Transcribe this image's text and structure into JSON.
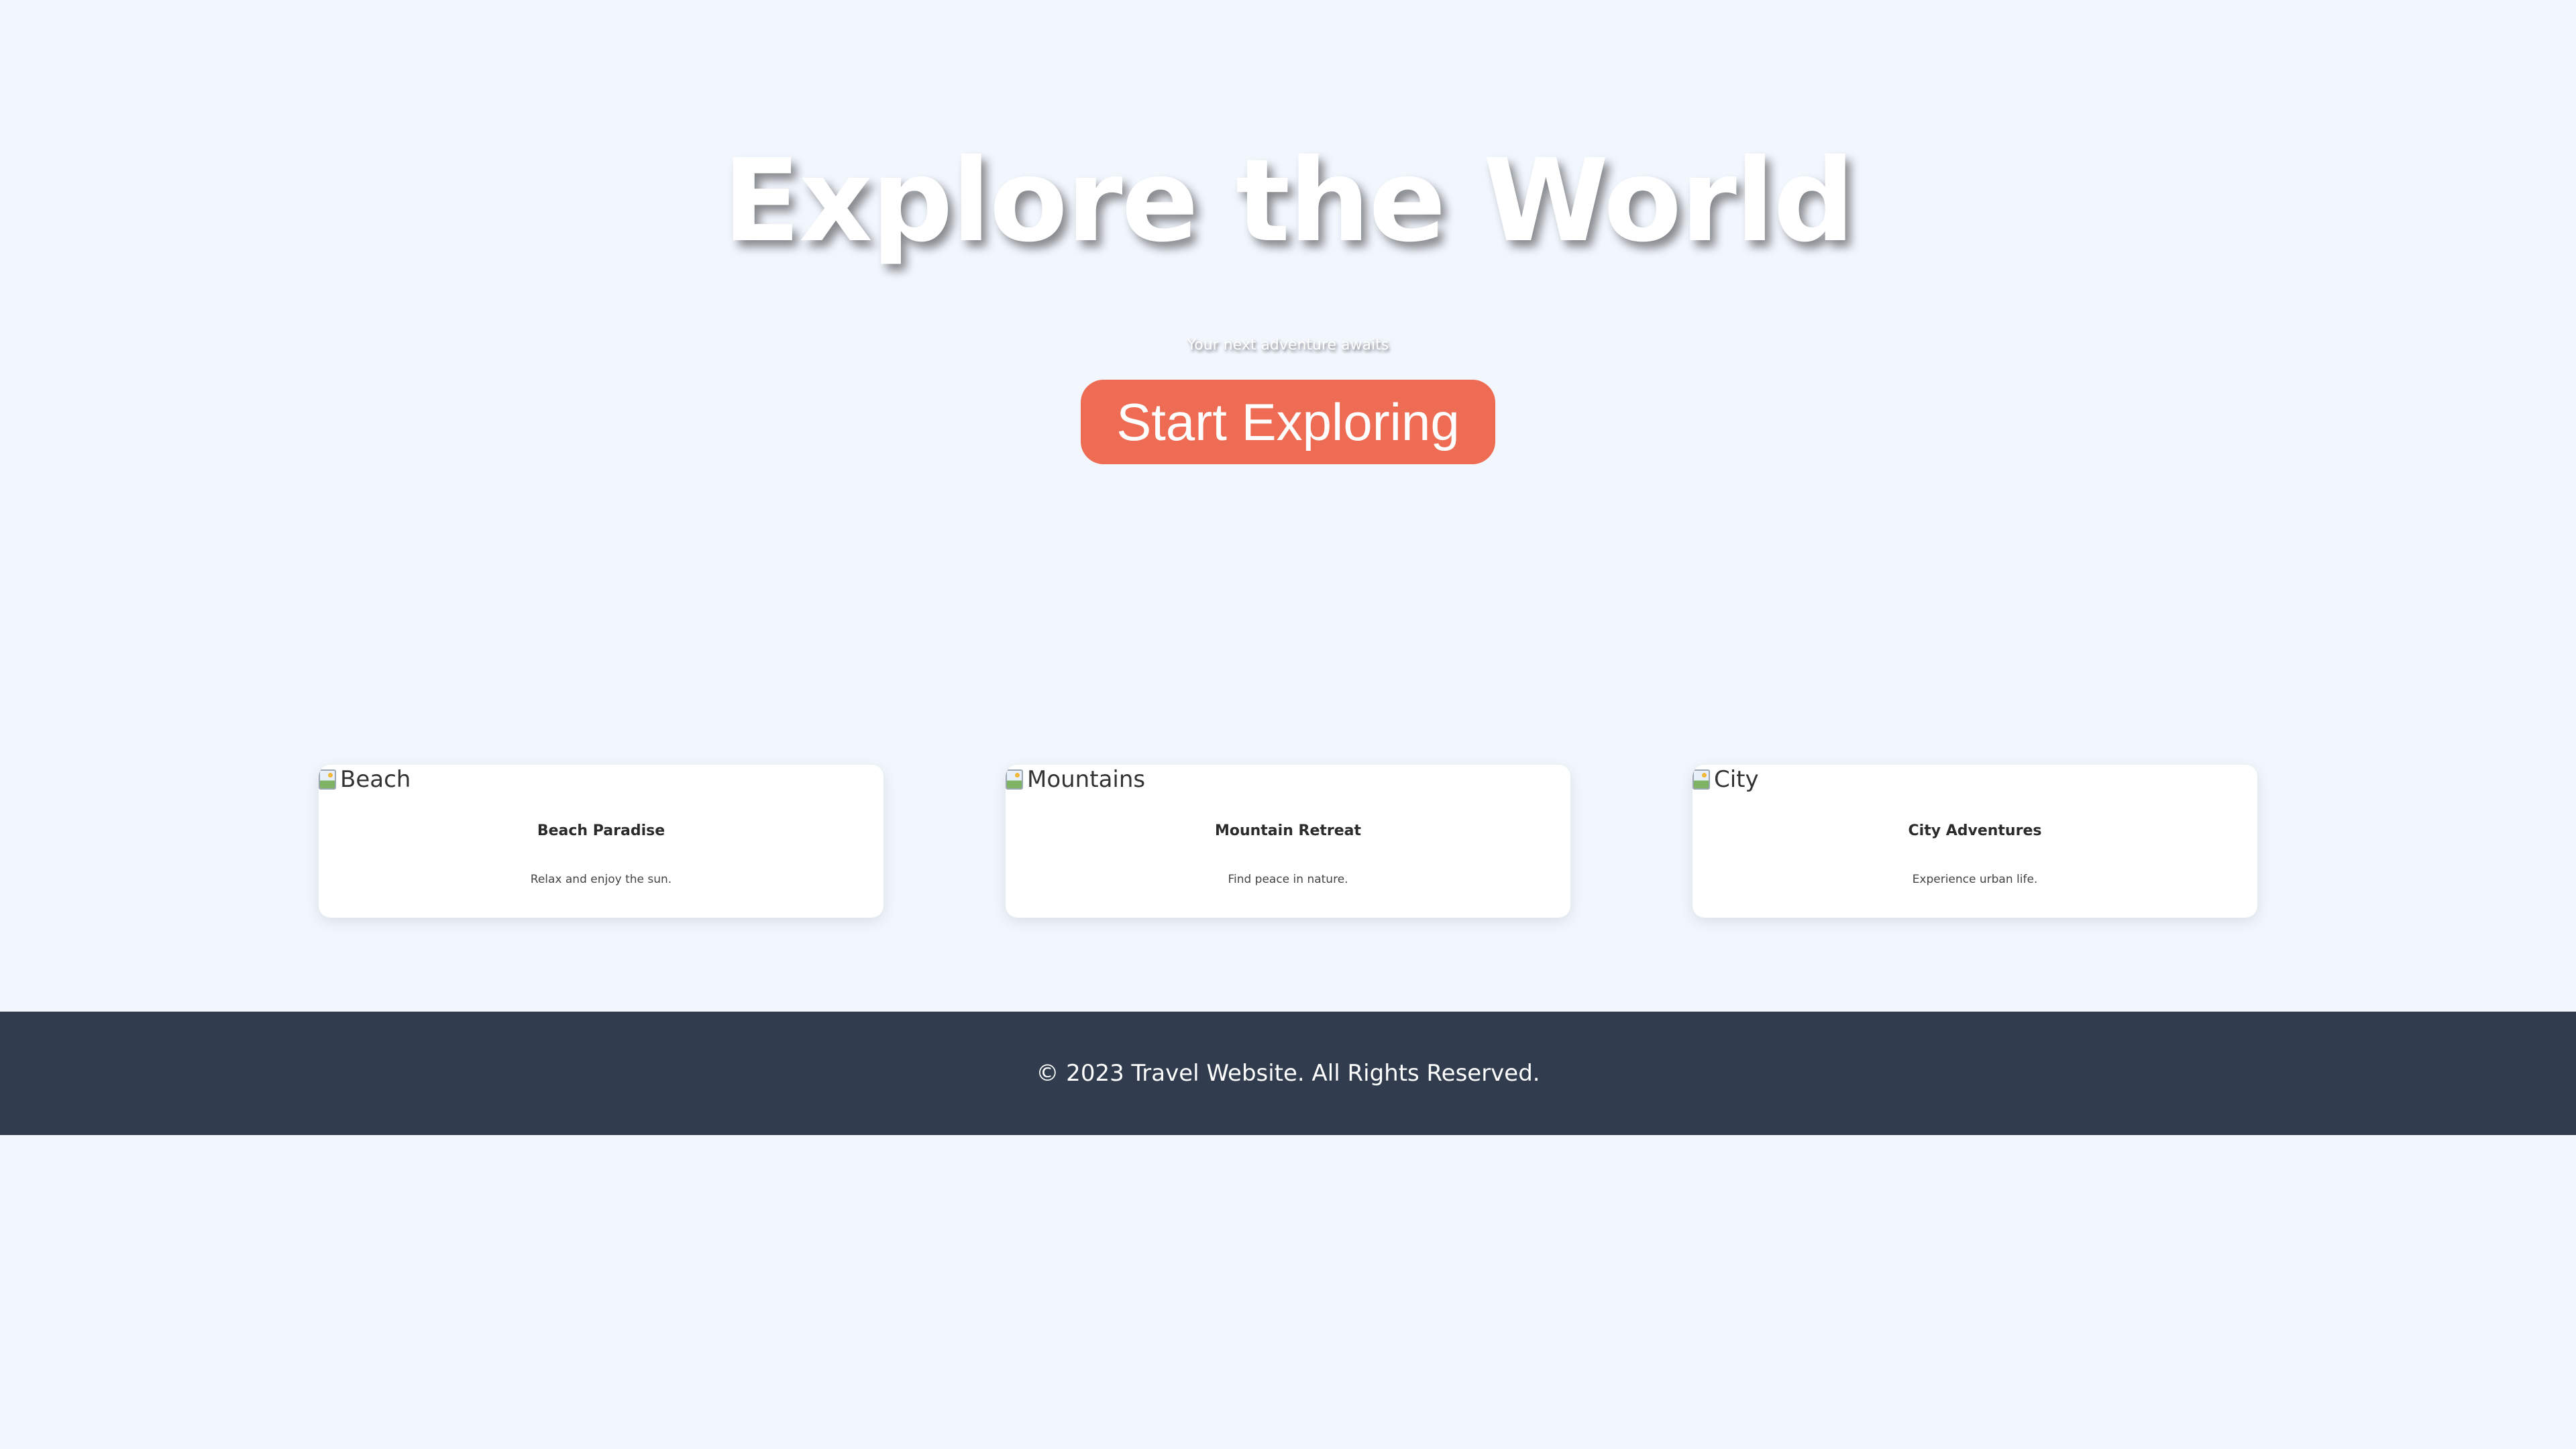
{
  "hero": {
    "title": "Explore the World",
    "subtitle": "Your next adventure awaits",
    "cta_label": "Start Exploring"
  },
  "cards": [
    {
      "image_alt": "Beach",
      "title": "Beach Paradise",
      "description": "Relax and enjoy the sun."
    },
    {
      "image_alt": "Mountains",
      "title": "Mountain Retreat",
      "description": "Find peace in nature."
    },
    {
      "image_alt": "City",
      "title": "City Adventures",
      "description": "Experience urban life."
    }
  ],
  "footer": {
    "text": "© 2023 Travel Website. All Rights Reserved."
  },
  "colors": {
    "background": "#f2f7fe",
    "cta": "#ee6c53",
    "footer": "#313d4e",
    "card": "#ffffff"
  },
  "icons": {
    "card_image": "broken-image-icon"
  }
}
